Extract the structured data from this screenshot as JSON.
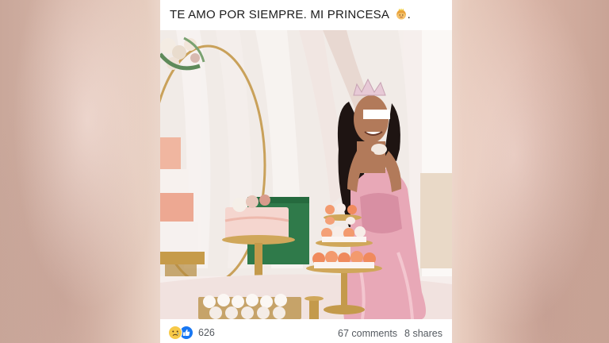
{
  "post": {
    "caption": "TE AMO POR SIEMPRE.  MI PRINCESA",
    "caption_emoji": "princess-emoji",
    "caption_end": ".",
    "reaction_icons": [
      "sad-reaction-icon",
      "like-reaction-icon"
    ],
    "reaction_count": "626",
    "comments": "67 comments",
    "shares": "8 shares"
  },
  "colors": {
    "like_blue": "#1877f2",
    "sad_yellow": "#f7c948",
    "text": "#1c1c1c",
    "muted": "#555a60"
  }
}
